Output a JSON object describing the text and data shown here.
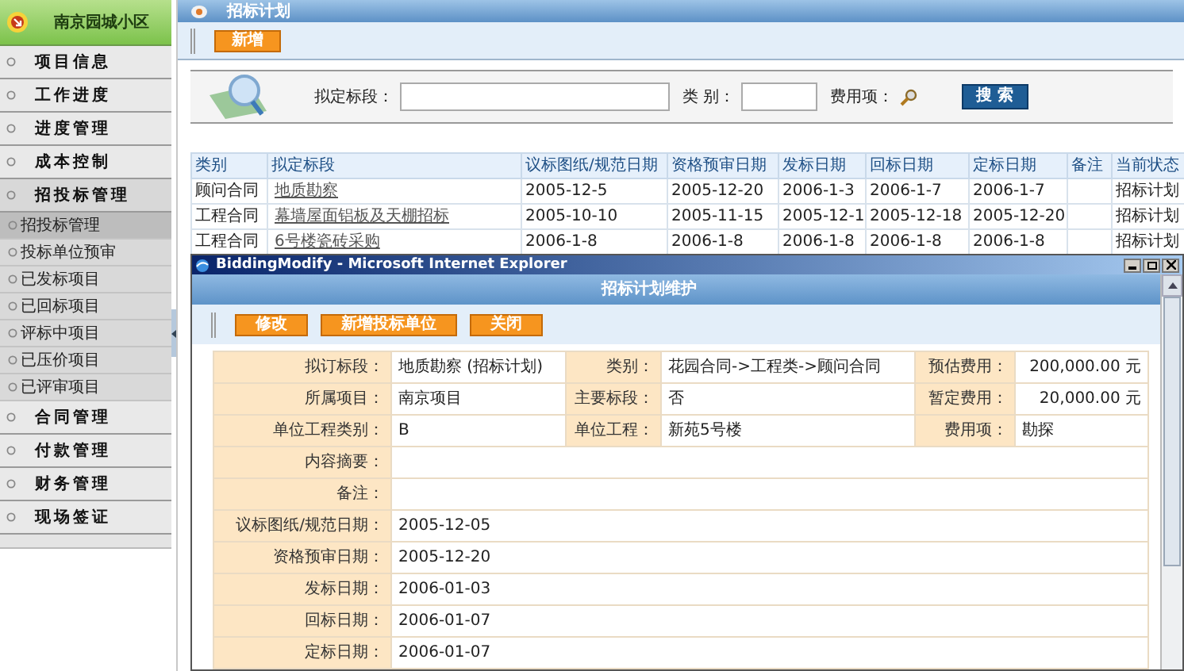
{
  "sidebar": {
    "header": "南京园城小区",
    "items": [
      {
        "label": "项目信息",
        "expanded": false
      },
      {
        "label": "工作进度",
        "expanded": false
      },
      {
        "label": "进度管理",
        "expanded": false
      },
      {
        "label": "成本控制",
        "expanded": false
      },
      {
        "label": "招投标管理",
        "expanded": true,
        "children": [
          {
            "label": "招投标管理",
            "selected": true
          },
          {
            "label": "投标单位预审",
            "selected": false
          },
          {
            "label": "已发标项目",
            "selected": false
          },
          {
            "label": "已回标项目",
            "selected": false
          },
          {
            "label": "评标中项目",
            "selected": false
          },
          {
            "label": "已压价项目",
            "selected": false
          },
          {
            "label": "已评审项目",
            "selected": false
          }
        ]
      },
      {
        "label": "合同管理",
        "expanded": false
      },
      {
        "label": "付款管理",
        "expanded": false
      },
      {
        "label": "财务管理",
        "expanded": false
      },
      {
        "label": "现场签证",
        "expanded": false
      }
    ]
  },
  "page": {
    "title": "招标计划",
    "toolbar": [
      "新增"
    ],
    "search": {
      "fields": [
        {
          "label": "拟定标段：",
          "kind": "input"
        },
        {
          "label": "类 别：",
          "kind": "short-input"
        },
        {
          "label": "费用项：",
          "kind": "lookup"
        }
      ],
      "button": "搜 索"
    },
    "table": {
      "columns": [
        {
          "label": "类别",
          "kind": "text"
        },
        {
          "label": "拟定标段",
          "kind": "link"
        },
        {
          "label": "议标图纸/规范日期",
          "kind": "text"
        },
        {
          "label": "资格预审日期",
          "kind": "text"
        },
        {
          "label": "发标日期",
          "kind": "text"
        },
        {
          "label": "回标日期",
          "kind": "text"
        },
        {
          "label": "定标日期",
          "kind": "text"
        },
        {
          "label": "备注",
          "kind": "text"
        },
        {
          "label": "当前状态",
          "kind": "text"
        }
      ],
      "rows": [
        {
          "cells": [
            "顾问合同",
            "地质勘察",
            "2005-12-5",
            "2005-12-20",
            "2006-1-3",
            "2006-1-7",
            "2006-1-7",
            null,
            "招标计划"
          ]
        },
        {
          "cells": [
            "工程合同",
            "幕墙屋面铝板及天棚招标",
            "2005-10-10",
            "2005-11-15",
            "2005-12-1",
            "2005-12-18",
            "2005-12-20",
            null,
            "招标计划"
          ]
        },
        {
          "cells": [
            "工程合同",
            "6号楼瓷砖采购",
            "2006-1-8",
            "2006-1-8",
            "2006-1-8",
            "2006-1-8",
            "2006-1-8",
            null,
            "招标计划"
          ]
        }
      ]
    }
  },
  "popup": {
    "title": "BiddingModify - Microsoft Internet Explorer",
    "header": "招标计划维护",
    "buttons": [
      "修改",
      "新增投标单位",
      "关闭"
    ],
    "form": [
      {
        "cells": [
          {
            "label": "拟订标段：",
            "value": "地质勘察 (招标计划)",
            "kind": "text"
          },
          {
            "label": "类别：",
            "value": "花园合同->工程类->顾问合同",
            "kind": "text"
          },
          {
            "label": "预估费用：",
            "value": "200,000.00 元",
            "kind": "amount"
          }
        ]
      },
      {
        "cells": [
          {
            "label": "所属项目：",
            "value": "南京项目",
            "kind": "text"
          },
          {
            "label": "主要标段：",
            "value": "否",
            "kind": "text"
          },
          {
            "label": "暂定费用：",
            "value": "20,000.00 元",
            "kind": "amount"
          }
        ]
      },
      {
        "cells": [
          {
            "label": "单位工程类别：",
            "value": "B",
            "kind": "text"
          },
          {
            "label": "单位工程：",
            "value": "新苑5号楼",
            "kind": "text"
          },
          {
            "label": "费用项：",
            "value": "勘探",
            "kind": "text"
          }
        ]
      },
      {
        "cells": [
          {
            "label": "内容摘要："
          }
        ]
      },
      {
        "cells": [
          {
            "label": "备注："
          }
        ]
      },
      {
        "cells": [
          {
            "label": "议标图纸/规范日期：",
            "value": "2005-12-05"
          }
        ]
      },
      {
        "cells": [
          {
            "label": "资格预审日期：",
            "value": "2005-12-20"
          }
        ]
      },
      {
        "cells": [
          {
            "label": "发标日期：",
            "value": "2006-01-03"
          }
        ]
      },
      {
        "cells": [
          {
            "label": "回标日期：",
            "value": "2006-01-07"
          }
        ]
      },
      {
        "cells": [
          {
            "label": "定标日期：",
            "value": "2006-01-07"
          }
        ]
      }
    ]
  }
}
